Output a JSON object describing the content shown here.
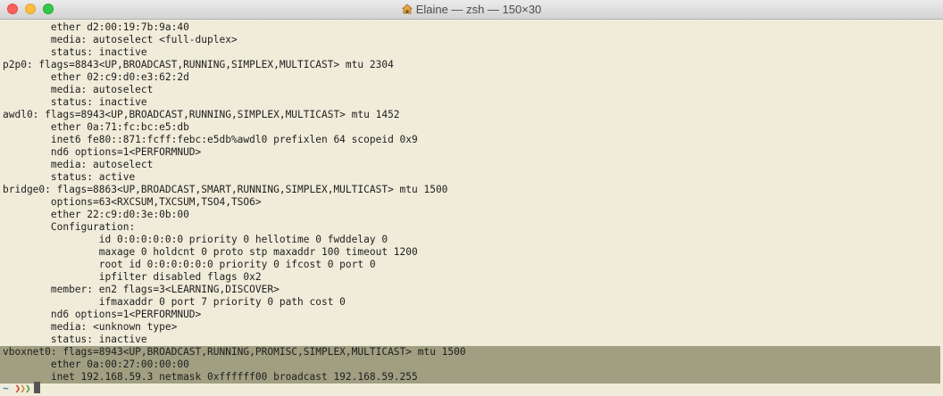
{
  "window": {
    "title": "Elaine — zsh — 150×30",
    "title_icon": "house-icon",
    "colors": {
      "background": "#f0ecda",
      "text": "#1e1e1e",
      "selection": "#a09f82"
    }
  },
  "terminal": {
    "lines": [
      "        ether d2:00:19:7b:9a:40",
      "        media: autoselect <full-duplex>",
      "        status: inactive",
      "p2p0: flags=8843<UP,BROADCAST,RUNNING,SIMPLEX,MULTICAST> mtu 2304",
      "        ether 02:c9:d0:e3:62:2d",
      "        media: autoselect",
      "        status: inactive",
      "awdl0: flags=8943<UP,BROADCAST,RUNNING,SIMPLEX,MULTICAST> mtu 1452",
      "        ether 0a:71:fc:bc:e5:db",
      "        inet6 fe80::871:fcff:febc:e5db%awdl0 prefixlen 64 scopeid 0x9",
      "        nd6 options=1<PERFORMNUD>",
      "        media: autoselect",
      "        status: active",
      "bridge0: flags=8863<UP,BROADCAST,SMART,RUNNING,SIMPLEX,MULTICAST> mtu 1500",
      "        options=63<RXCSUM,TXCSUM,TSO4,TSO6>",
      "        ether 22:c9:d0:3e:0b:00",
      "        Configuration:",
      "                id 0:0:0:0:0:0 priority 0 hellotime 0 fwddelay 0",
      "                maxage 0 holdcnt 0 proto stp maxaddr 100 timeout 1200",
      "                root id 0:0:0:0:0:0 priority 0 ifcost 0 port 0",
      "                ipfilter disabled flags 0x2",
      "        member: en2 flags=3<LEARNING,DISCOVER>",
      "                ifmaxaddr 0 port 7 priority 0 path cost 0",
      "        nd6 options=1<PERFORMNUD>",
      "        media: <unknown type>",
      "        status: inactive",
      "vboxnet0: flags=8943<UP,BROADCAST,RUNNING,PROMISC,SIMPLEX,MULTICAST> mtu 1500",
      "        ether 0a:00:27:00:00:00",
      "        inet 192.168.59.3 netmask 0xffffff00 broadcast 192.168.59.255"
    ],
    "highlighted_lines": [
      26,
      27,
      28
    ],
    "prompt": {
      "tilde": "~",
      "arrows": "❯❯❯"
    }
  }
}
